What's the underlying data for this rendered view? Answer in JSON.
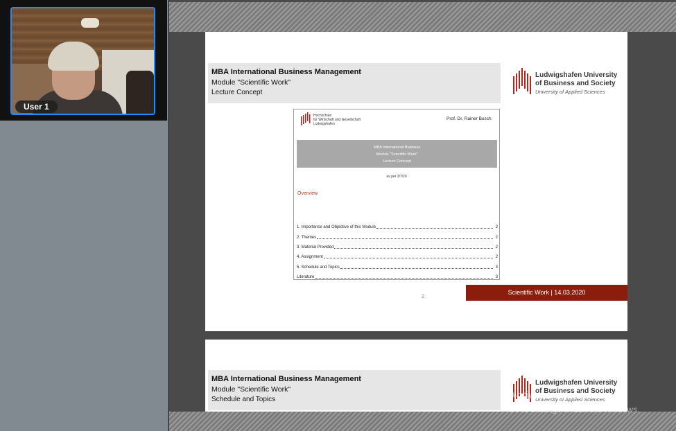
{
  "participant": {
    "name": "User 1"
  },
  "slides": [
    {
      "title": "MBA International Business Management",
      "module": "Module \"Scientific Work\"",
      "subtitle": "Lecture Concept",
      "logo": {
        "line1": "Ludwigshafen University",
        "line2": "of Business and Society",
        "tagline": "University of Applied Sciences"
      },
      "document": {
        "logo_line1": "Hochschule",
        "logo_line2": "für Wirtschaft und Gesellschaft",
        "logo_line3": "Ludwigshafen",
        "author": "Prof. Dr. Rainer Busch",
        "header_lines": [
          "MBA International Business",
          "Module \"Scientific Work\"",
          "Lecture Concept"
        ],
        "as_per": "as per 3/7/20",
        "overview_heading": "Overview",
        "toc": [
          {
            "title": "1. Importance and Objective of this Module",
            "page": "2"
          },
          {
            "title": "2. Themes",
            "page": "2"
          },
          {
            "title": "3. Material Provided",
            "page": "2"
          },
          {
            "title": "4. Assignment",
            "page": "2"
          },
          {
            "title": "5. Schedule and Topics",
            "page": "3"
          },
          {
            "title": "Literature",
            "page": "3"
          }
        ]
      },
      "page_number": "2",
      "footer": "Scientific Work | 14.03.2020"
    },
    {
      "title": "MBA International Business Management",
      "module": "Module \"Scientific Work\"",
      "subtitle": "Schedule and Topics",
      "logo": {
        "line1": "Ludwigshafen University",
        "line2": "of Business and Society",
        "tagline": "University of Applied Sciences"
      }
    }
  ],
  "watermark": {
    "title": "Activate Windows",
    "subtitle": "Go to Settings to activate Windows."
  },
  "colors": {
    "accent_red": "#8b1d0c",
    "video_border": "#1e8cff"
  }
}
